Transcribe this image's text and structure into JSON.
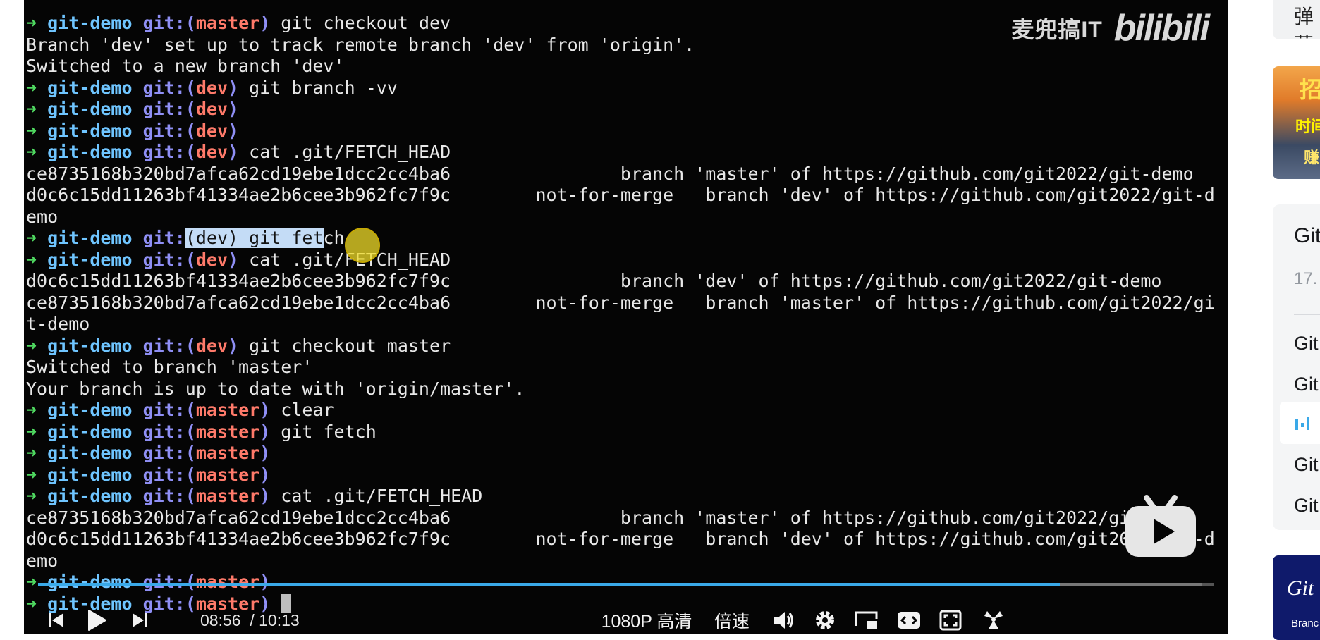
{
  "terminal": {
    "lines": [
      {
        "arrow": "➜",
        "dir": "git-demo",
        "git": "git:(",
        "branch": "master",
        "close": ")",
        "cmd": " git checkout dev"
      },
      {
        "text": "Branch 'dev' set up to track remote branch 'dev' from 'origin'."
      },
      {
        "text": "Switched to a new branch 'dev'"
      },
      {
        "arrow": "➜",
        "dir": "git-demo",
        "git": "git:(",
        "branch": "dev",
        "close": ")",
        "cmd": " git branch -vv"
      },
      {
        "arrow": "➜",
        "dir": "git-demo",
        "git": "git:(",
        "branch": "dev",
        "close": ")",
        "cmd": ""
      },
      {
        "arrow": "➜",
        "dir": "git-demo",
        "git": "git:(",
        "branch": "dev",
        "close": ")",
        "cmd": ""
      },
      {
        "arrow": "➜",
        "dir": "git-demo",
        "git": "git:(",
        "branch": "dev",
        "close": ")",
        "cmd": " cat .git/FETCH_HEAD"
      },
      {
        "text": "ce8735168b320bd7afca62cd19ebe1dcc2cc4ba6                branch 'master' of https://github.com/git2022/git-demo"
      },
      {
        "text": "d0c6c15dd11263bf41334ae2b6cee3b962fc7f9c        not-for-merge   branch 'dev' of https://github.com/git2022/git-d"
      },
      {
        "text": "emo"
      },
      {
        "arrow": "➜",
        "dir": "git-demo",
        "git": "git:",
        "selected": "(dev) git fet",
        "rest": "ch"
      },
      {
        "arrow": "➜",
        "dir": "git-demo",
        "git": "git:(",
        "branch": "dev",
        "close": ")",
        "cmd": " cat .git/FETCH_HEAD"
      },
      {
        "text": "d0c6c15dd11263bf41334ae2b6cee3b962fc7f9c                branch 'dev' of https://github.com/git2022/git-demo"
      },
      {
        "text": "ce8735168b320bd7afca62cd19ebe1dcc2cc4ba6        not-for-merge   branch 'master' of https://github.com/git2022/gi"
      },
      {
        "text": "t-demo"
      },
      {
        "arrow": "➜",
        "dir": "git-demo",
        "git": "git:(",
        "branch": "dev",
        "close": ")",
        "cmd": " git checkout master"
      },
      {
        "text": "Switched to branch 'master'"
      },
      {
        "text": "Your branch is up to date with 'origin/master'."
      },
      {
        "arrow": "➜",
        "dir": "git-demo",
        "git": "git:(",
        "branch": "master",
        "close": ")",
        "cmd": " clear"
      },
      {
        "arrow": "➜",
        "dir": "git-demo",
        "git": "git:(",
        "branch": "master",
        "close": ")",
        "cmd": " git fetch"
      },
      {
        "arrow": "➜",
        "dir": "git-demo",
        "git": "git:(",
        "branch": "master",
        "close": ")",
        "cmd": ""
      },
      {
        "arrow": "➜",
        "dir": "git-demo",
        "git": "git:(",
        "branch": "master",
        "close": ")",
        "cmd": ""
      },
      {
        "arrow": "➜",
        "dir": "git-demo",
        "git": "git:(",
        "branch": "master",
        "close": ")",
        "cmd": " cat .git/FETCH_HEAD"
      },
      {
        "text": "ce8735168b320bd7afca62cd19ebe1dcc2cc4ba6                branch 'master' of https://github.com/git2022/git-demo"
      },
      {
        "text": "d0c6c15dd11263bf41334ae2b6cee3b962fc7f9c        not-for-merge   branch 'dev' of https://github.com/git2022/git-d"
      },
      {
        "text": "emo"
      },
      {
        "arrow": "➜",
        "dir": "git-demo",
        "git": "git:(",
        "branch": "master",
        "close": ")",
        "cmd": ""
      },
      {
        "arrow": "➜",
        "dir": "git-demo",
        "git": "git:(",
        "branch": "master",
        "close": ")",
        "cmd": " ",
        "cursor": true
      }
    ]
  },
  "watermark": {
    "text": "麦兜搞IT",
    "logo": "bilibili"
  },
  "player": {
    "progress": 0.869,
    "buffered": 0.99,
    "current_time": "08:56",
    "separator": "/",
    "duration": "10:13",
    "quality": "1080P 高清",
    "speed": "倍速",
    "colors": {
      "accent": "#3aa9e8",
      "terminal_bg": "#050505"
    },
    "icons": [
      "prev-icon",
      "play-icon",
      "next-icon",
      "volume-icon",
      "settings-icon",
      "pip-icon",
      "widescreen-icon",
      "fullscreen-icon",
      "danmaku-icon",
      "bilibili-tv-icon"
    ]
  },
  "sidebar": {
    "danmaku_label": "弹幕",
    "thumb_lines": [
      "招",
      "时间",
      "赚"
    ],
    "playlist_title": "Git",
    "playlist_meta": "17.",
    "items": [
      "Git",
      "Git",
      "",
      "Git",
      "Git"
    ],
    "bottom_thumb_title": "Git",
    "bottom_thumb_sub": "Branc"
  }
}
